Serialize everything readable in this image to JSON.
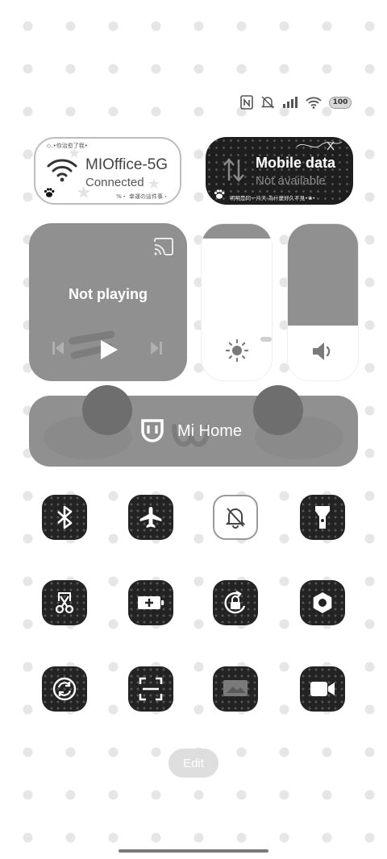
{
  "status_bar": {
    "icons": [
      "nfc-icon",
      "mute-vibrate-icon",
      "signal-icon",
      "wifi-icon"
    ],
    "battery": "100"
  },
  "wifi_card": {
    "name": "MIOffice-5G",
    "status": "Connected",
    "deco_top": "◇.•你治愈了我•",
    "deco_bottom": "%・ 幸運の這件事・"
  },
  "mobile_card": {
    "name": "Mobile data",
    "status": "Not available",
    "deco_bottom": "明明是同一片天 為什麼好久不見•❀•"
  },
  "media": {
    "status": "Not playing",
    "controls": [
      "previous-icon",
      "play-icon",
      "next-icon"
    ]
  },
  "sliders": {
    "brightness_level": 0.08,
    "volume_level": 0.35
  },
  "mi_home": {
    "label": "Mi Home"
  },
  "toggles": [
    {
      "name": "bluetooth",
      "active": true
    },
    {
      "name": "airplane-mode",
      "active": true
    },
    {
      "name": "mute",
      "active": false
    },
    {
      "name": "flashlight",
      "active": true
    },
    {
      "name": "screenshot",
      "active": true
    },
    {
      "name": "battery-saver",
      "active": true
    },
    {
      "name": "rotation-lock",
      "active": true
    },
    {
      "name": "settings",
      "active": true
    },
    {
      "name": "sync",
      "active": true
    },
    {
      "name": "scanner",
      "active": true
    },
    {
      "name": "cast",
      "active": true
    },
    {
      "name": "screen-recorder",
      "active": true
    }
  ],
  "footer": {
    "edit_label": "Edit"
  },
  "colors": {
    "tile_dark": "#232323",
    "panel_gray": "#909090",
    "background": "#ffffff"
  }
}
